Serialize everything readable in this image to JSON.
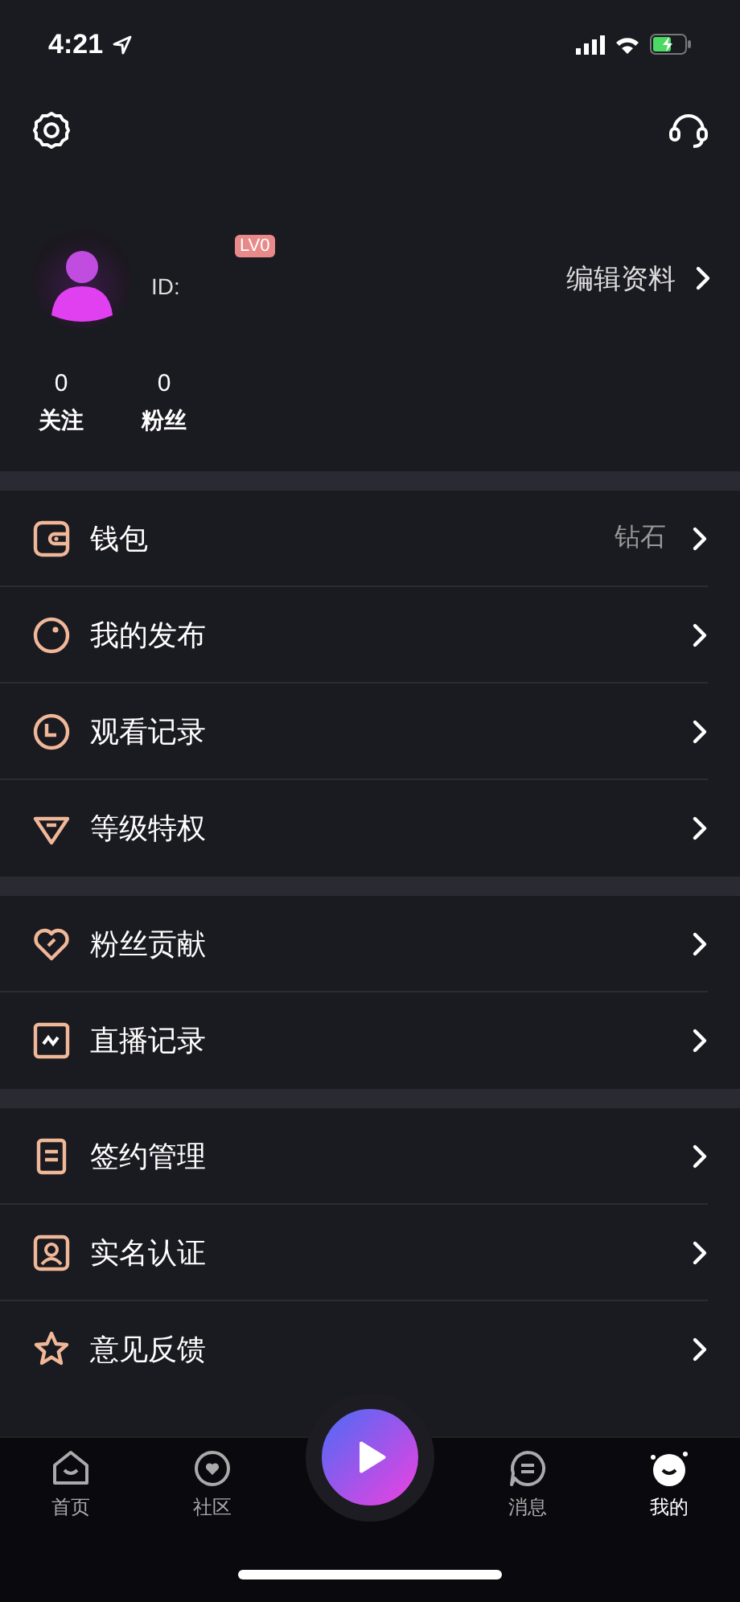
{
  "status_bar": {
    "time": "4:21"
  },
  "profile": {
    "level_badge": "LV0",
    "id_label": "ID:",
    "edit_link": "编辑资料",
    "stats": [
      {
        "value": "0",
        "label": "关注"
      },
      {
        "value": "0",
        "label": "粉丝"
      }
    ]
  },
  "menu_groups": [
    {
      "items": [
        {
          "label": "钱包",
          "value": "钻石"
        },
        {
          "label": "我的发布"
        },
        {
          "label": "观看记录"
        },
        {
          "label": "等级特权"
        }
      ]
    },
    {
      "items": [
        {
          "label": "粉丝贡献"
        },
        {
          "label": "直播记录"
        }
      ]
    },
    {
      "items": [
        {
          "label": "签约管理"
        },
        {
          "label": "实名认证"
        },
        {
          "label": "意见反馈"
        }
      ]
    }
  ],
  "tab_bar": [
    {
      "label": "首页",
      "selected": false
    },
    {
      "label": "社区",
      "selected": false
    },
    {
      "label": "消息",
      "selected": false
    },
    {
      "label": "我的",
      "selected": true
    }
  ]
}
